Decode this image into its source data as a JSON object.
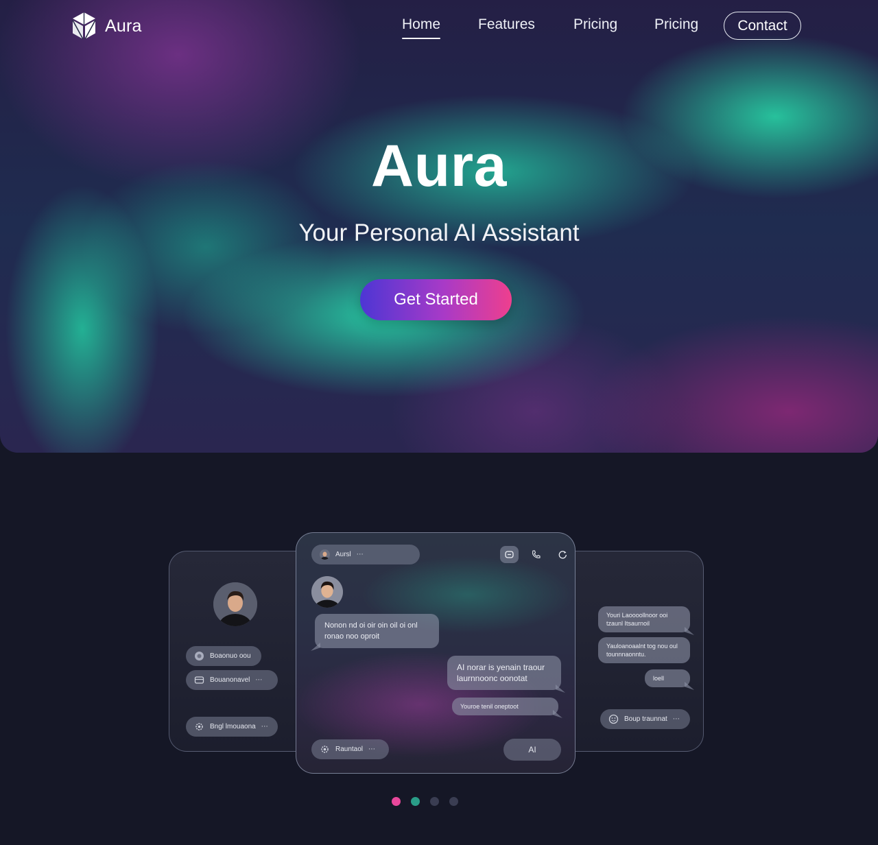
{
  "brand": {
    "name": "Aura"
  },
  "nav": {
    "links": [
      "Home",
      "Features",
      "Pricing",
      "Pricing"
    ],
    "active": "Home",
    "contact_label": "Contact"
  },
  "hero": {
    "title": "Aura",
    "subtitle": "Your Personal AI Assistant",
    "cta_label": "Get Started"
  },
  "mockup": {
    "left_panel": {
      "items": [
        "Boaonuo oou",
        "Bouanonavel",
        "Bngl lmouaona"
      ]
    },
    "main_panel": {
      "header_name": "Aursl",
      "messages": {
        "incoming": "Nonon nd oi oir oin oil oi onl ronao noo oproit",
        "outgoing_1": "AI norar is yenain traour laurnnoonc oonotat",
        "outgoing_2": "Youroe tenil oneptoot"
      },
      "input_label": "Rauntaol",
      "ai_button_label": "AI"
    },
    "right_panel": {
      "bubbles": [
        "Youri Laoooollnoor ooi tzaunl Itsaurnoil",
        "Yauloanoaalnt tog nou oul tounnnaonntu.",
        "loell"
      ],
      "pill_label": "Boup traunnat"
    }
  },
  "carousel": {
    "dot_colors": [
      "#e8479b",
      "#2a9d88",
      "#3a3d52",
      "#3a3d52"
    ],
    "active_index": 0
  },
  "colors": {
    "background": "#151726",
    "cta_gradient_start": "#4d36d4",
    "cta_gradient_end": "#ee3f8e",
    "aurora_green": "#28d8a8",
    "aurora_purple": "#7a328c"
  }
}
